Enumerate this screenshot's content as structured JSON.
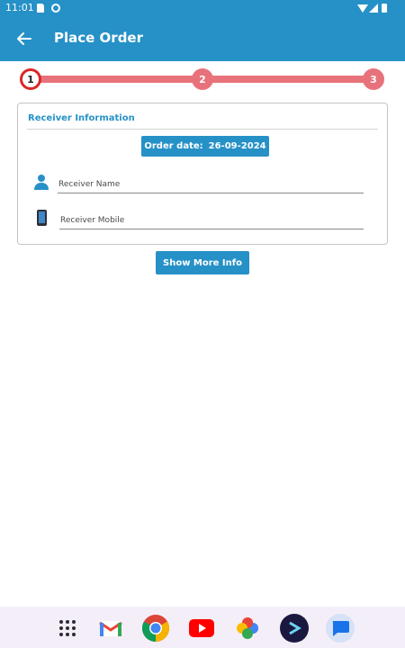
{
  "status_bar": {
    "time": "11:01"
  },
  "app_bar": {
    "title": "Place Order",
    "back_icon": "arrow-back-icon"
  },
  "stepper": {
    "current_step": 1,
    "steps": [
      "1",
      "2",
      "3"
    ]
  },
  "receiver_card": {
    "title": "Receiver Information",
    "order_date_label": "Order date:",
    "order_date_value": "26-09-2024",
    "fields": {
      "name": {
        "placeholder": "Receiver Name",
        "value": ""
      },
      "mobile": {
        "placeholder": "Receiver Mobile",
        "value": ""
      }
    }
  },
  "show_more_info_label": "Show More Info",
  "dock": {
    "apps": [
      "app-drawer",
      "gmail",
      "chrome",
      "youtube",
      "photos",
      "shyft",
      "messages"
    ]
  },
  "colors": {
    "primary": "#2691c7",
    "step_track": "#e8727b",
    "step_active_ring": "#d92828"
  }
}
